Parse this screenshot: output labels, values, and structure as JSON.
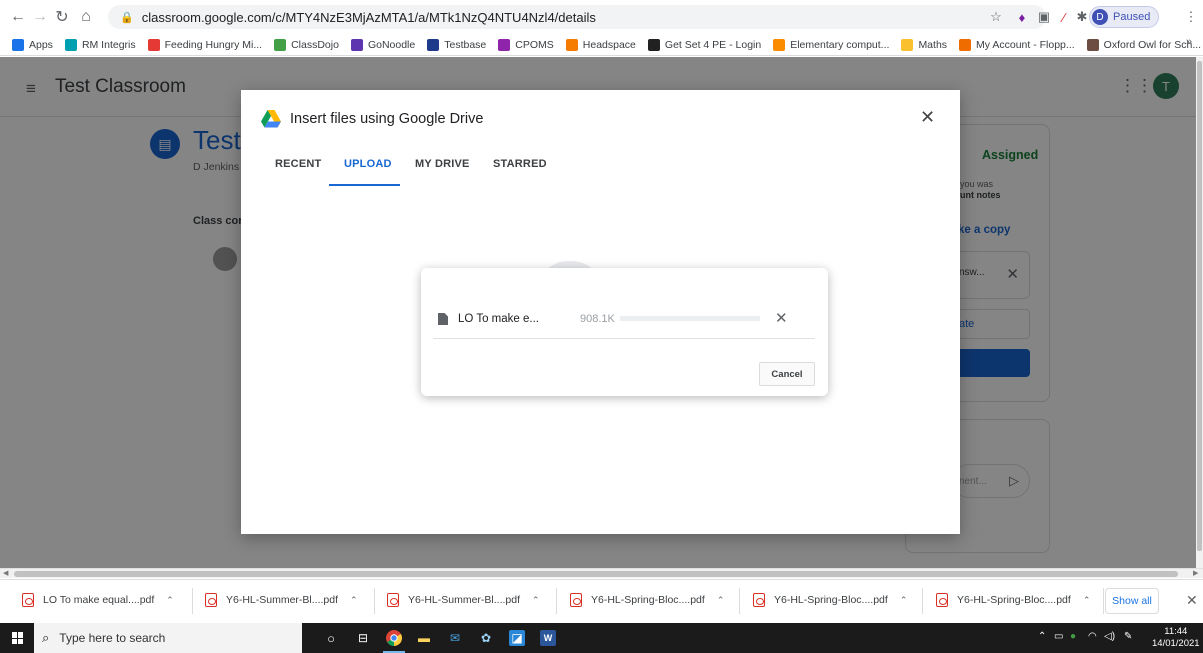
{
  "browser": {
    "url": "classroom.google.com/c/MTY4NzE3MjAzMTA1/a/MTk1NzQ4NTU4Nzl4/details",
    "profile_initial": "D",
    "profile_status": "Paused",
    "bookmarks": [
      {
        "label": "Apps",
        "color": "#1a73e8"
      },
      {
        "label": "RM Integris",
        "color": "#00a0b0"
      },
      {
        "label": "Feeding Hungry Mi...",
        "color": "#e53935"
      },
      {
        "label": "ClassDojo",
        "color": "#43a047"
      },
      {
        "label": "GoNoodle",
        "color": "#5e35b1"
      },
      {
        "label": "Testbase",
        "color": "#1e3a8a"
      },
      {
        "label": "CPOMS",
        "color": "#8e24aa"
      },
      {
        "label": "Headspace",
        "color": "#f57c00"
      },
      {
        "label": "Get Set 4 PE - Login",
        "color": "#212121"
      },
      {
        "label": "Elementary comput...",
        "color": "#fb8c00"
      },
      {
        "label": "Maths",
        "color": "#fbc02d"
      },
      {
        "label": "My Account - Flopp...",
        "color": "#ef6c00"
      },
      {
        "label": "Oxford Owl for Sch...",
        "color": "#6d4c41"
      }
    ]
  },
  "classroom": {
    "class_name": "Test Classroom",
    "user_initial": "T",
    "assignment_title": "Test",
    "author": "D Jenkins",
    "class_comments": "Class cor",
    "status": "Assigned",
    "note_line1": "you was",
    "note_line2": "unt notes",
    "make_copy": "ke a copy",
    "file_chip": "nsw...",
    "create_label": "ate",
    "comment_placeholder": "nent..."
  },
  "picker": {
    "title": "Insert files using Google Drive",
    "tabs": [
      "RECENT",
      "UPLOAD",
      "MY DRIVE",
      "STARRED"
    ],
    "active_tab": "UPLOAD"
  },
  "upload": {
    "file_name": "LO To make e...",
    "file_size": "908.1K",
    "progress_fraction": 0.0,
    "cancel_label": "Cancel"
  },
  "downloads": {
    "items": [
      "LO To make equal....pdf",
      "Y6-HL-Summer-Bl....pdf",
      "Y6-HL-Summer-Bl....pdf",
      "Y6-HL-Spring-Bloc....pdf",
      "Y6-HL-Spring-Bloc....pdf",
      "Y6-HL-Spring-Bloc....pdf"
    ],
    "show_all": "Show all"
  },
  "taskbar": {
    "search_placeholder": "Type here to search",
    "time": "11:44",
    "date": "14/01/2021"
  }
}
